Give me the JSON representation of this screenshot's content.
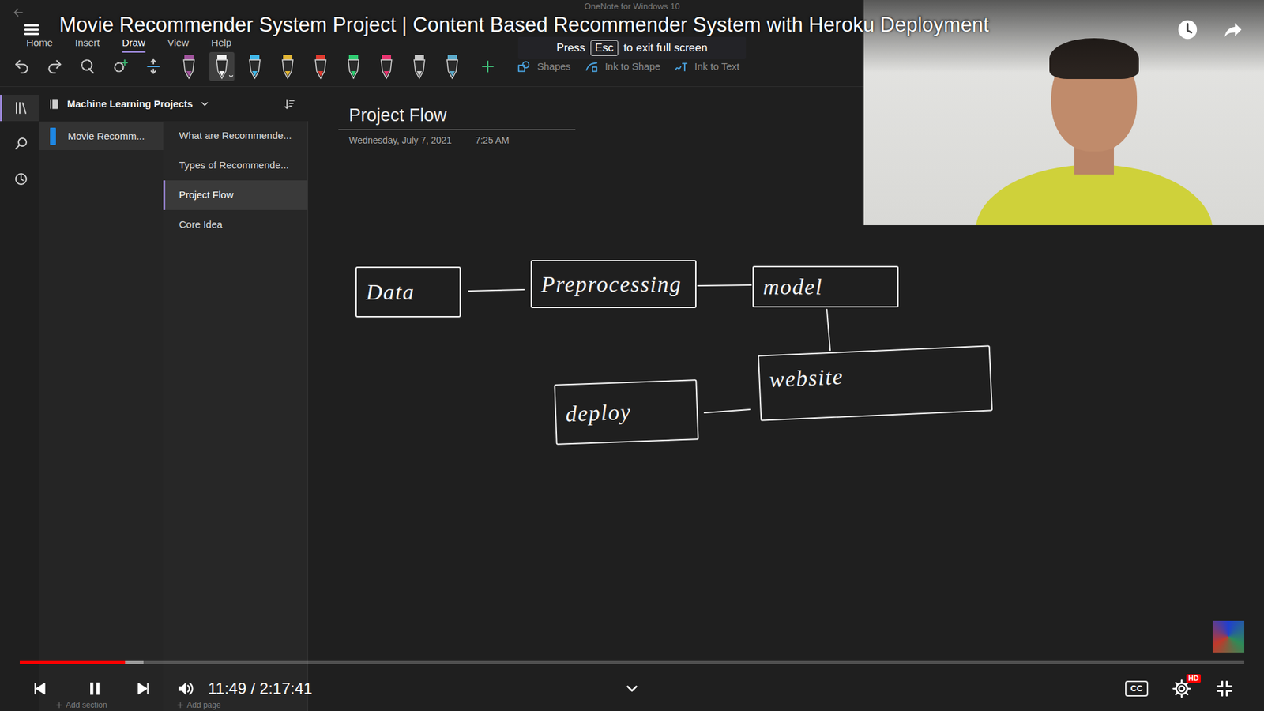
{
  "video": {
    "title": "Movie Recommender System Project | Content Based Recommender System with Heroku Deployment",
    "toast": {
      "before": "Press",
      "key": "Esc",
      "after": "to exit full screen"
    },
    "progress": {
      "level": 0.086,
      "buffered": 0.101
    },
    "time": "11:49 / 2:17:41",
    "captions": "CC",
    "quality_badge": "HD",
    "playing": true
  },
  "window": {
    "title": "OneNote for Windows 10"
  },
  "menu": [
    {
      "label": "Home",
      "selected": false
    },
    {
      "label": "Insert",
      "selected": false
    },
    {
      "label": "Draw",
      "selected": true
    },
    {
      "label": "View",
      "selected": false
    },
    {
      "label": "Help",
      "selected": false
    }
  ],
  "pens": [
    {
      "color": "#a0529c",
      "selected": false
    },
    {
      "color": "#f2f2f2",
      "selected": true
    },
    {
      "color": "#3fb6e8",
      "selected": false
    },
    {
      "color": "#e2b634",
      "selected": false
    },
    {
      "color": "#e03a2e",
      "selected": false
    },
    {
      "color": "#2ecc71",
      "selected": false
    },
    {
      "color": "#e8336f",
      "selected": false
    },
    {
      "color": "#c8c8c8",
      "selected": false
    },
    {
      "color": "#5aa9c9",
      "selected": false
    }
  ],
  "ribbon_buttons": [
    "Shapes",
    "Ink to Shape",
    "Ink to Text"
  ],
  "nav": [
    {
      "kind": "notebooks",
      "selected": true
    },
    {
      "kind": "search",
      "selected": false
    },
    {
      "kind": "recent",
      "selected": false
    }
  ],
  "notebook": {
    "name": "Machine Learning Projects"
  },
  "sections": [
    {
      "label": "Movie Recomm...",
      "selected": true
    }
  ],
  "pages": [
    {
      "label": "What are Recommende...",
      "selected": false
    },
    {
      "label": "Types of Recommende...",
      "selected": false
    },
    {
      "label": "Project Flow",
      "selected": true
    },
    {
      "label": "Core Idea",
      "selected": false
    }
  ],
  "page": {
    "title": "Project Flow",
    "date": "Wednesday, July 7, 2021",
    "time": "7:25 AM"
  },
  "diagram": {
    "nodes": [
      {
        "label": "Data"
      },
      {
        "label": "Preprocessing"
      },
      {
        "label": "model"
      },
      {
        "label": "website"
      },
      {
        "label": "deploy"
      }
    ]
  },
  "footer": {
    "add_section": "Add section",
    "add_page": "Add page"
  }
}
